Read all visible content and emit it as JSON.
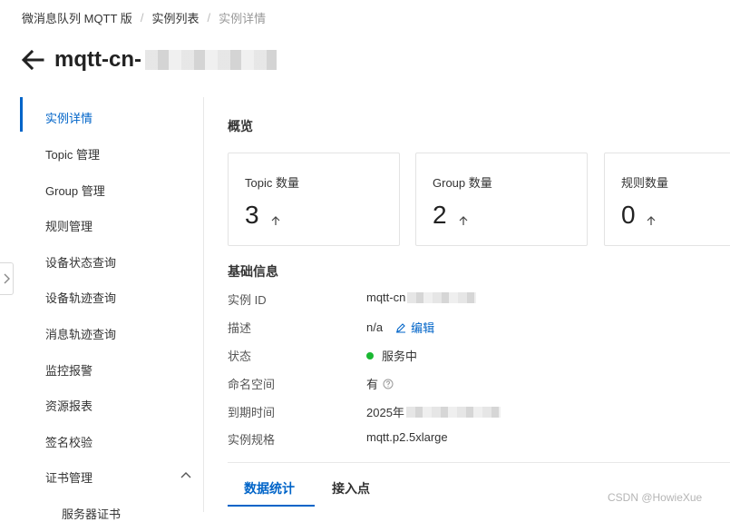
{
  "breadcrumb": {
    "items": [
      "微消息队列 MQTT 版",
      "实例列表",
      "实例详情"
    ]
  },
  "header": {
    "title": "mqtt-cn-"
  },
  "sidebar": {
    "items": [
      "实例详情",
      "Topic 管理",
      "Group 管理",
      "规则管理",
      "设备状态查询",
      "设备轨迹查询",
      "消息轨迹查询",
      "监控报警",
      "资源报表",
      "签名校验",
      "证书管理"
    ],
    "active_index": 0,
    "sub_item": "服务器证书"
  },
  "overview": {
    "title": "概览",
    "cards": [
      {
        "label": "Topic 数量",
        "value": "3"
      },
      {
        "label": "Group 数量",
        "value": "2"
      },
      {
        "label": "规则数量",
        "value": "0"
      }
    ]
  },
  "basic_info": {
    "title": "基础信息",
    "rows": [
      {
        "label": "实例 ID",
        "value": "mqtt-cn"
      },
      {
        "label": "描述",
        "value": "n/a",
        "edit_label": "编辑"
      },
      {
        "label": "状态",
        "value": "服务中"
      },
      {
        "label": "命名空间",
        "value": "有"
      },
      {
        "label": "到期时间",
        "value": "2025年"
      },
      {
        "label": "实例规格",
        "value": "mqtt.p2.5xlarge"
      }
    ]
  },
  "tabs": [
    "数据统计",
    "接入点"
  ],
  "colors": {
    "accent": "#0064c8",
    "status_ok": "#1ab832"
  },
  "watermark": "CSDN @HowieXue"
}
